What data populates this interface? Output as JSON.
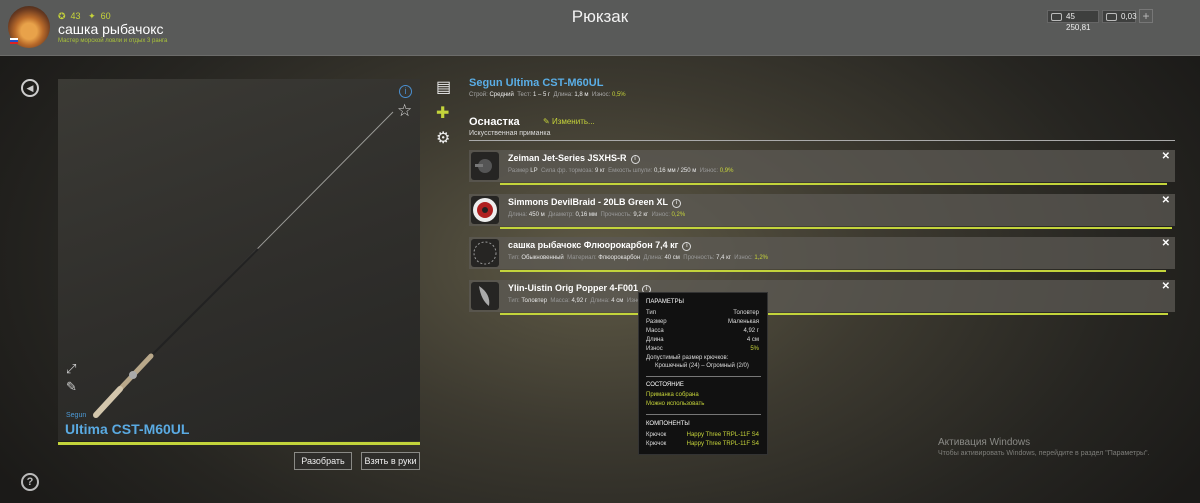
{
  "header": {
    "title": "Рюкзак",
    "level": "43",
    "points": "60",
    "username": "сашка рыбачокс",
    "rank": "Мастер морской ловли и отдых 3 ранга",
    "silver": "45 250,81",
    "gold": "0,03",
    "plus": "+"
  },
  "preview": {
    "info_glyph": "i",
    "brand": "Segun",
    "model": "Ultima CST-M60UL",
    "disassemble_label": "Разобрать",
    "take_label": "Взять в руки"
  },
  "rod": {
    "name": "Segun Ultima CST-M60UL",
    "props": [
      {
        "label": "Строй:",
        "value": "Средний"
      },
      {
        "label": "Тест:",
        "value": "1 – 5 г"
      },
      {
        "label": "Длина:",
        "value": "1,8 м"
      },
      {
        "label": "Износ:",
        "value": "0,5%"
      }
    ]
  },
  "tackle": {
    "section_title": "Оснастка",
    "change_label": "Изменить...",
    "lure_type": "Искусственная приманка",
    "items": [
      {
        "name": "Zeiman Jet-Series JSXHS-R",
        "info": "i",
        "p1l": "Размер",
        "p1v": "LP",
        "p2l": "Сила фр. тормоза:",
        "p2v": "9 кг",
        "p3l": "Емкость шпули:",
        "p3v": "0,16 мм / 250 м",
        "p4l": "Износ:",
        "p4v": "0,9%"
      },
      {
        "name": "Simmons DevilBraid - 20LB Green XL",
        "info": "i",
        "p1l": "Длина:",
        "p1v": "450 м",
        "p2l": "Диаметр:",
        "p2v": "0,16 мм",
        "p3l": "Прочность:",
        "p3v": "9,2 кг",
        "p4l": "Износ:",
        "p4v": "0,2%"
      },
      {
        "name": "сашка рыбачокс Флюорокарбон 7,4 кг",
        "info": "i",
        "p1l": "Тип:",
        "p1v": "Обыкновенный",
        "p2l": "Материал:",
        "p2v": "Флюорокарбон",
        "p3l": "Длина:",
        "p3v": "40 см",
        "p4l": "Прочность:",
        "p4v": "7,4 кг",
        "p5l": "Износ:",
        "p5v": "1,2%"
      },
      {
        "name": "Ylin-Uistin Orig Popper 4-F001",
        "info": "i",
        "p1l": "Тип:",
        "p1v": "Толовтер",
        "p2l": "Масса:",
        "p2v": "4,92 г",
        "p3l": "Длина:",
        "p3v": "4 см",
        "p4l": "Износ:",
        "p4v": ""
      }
    ],
    "close_glyph": "✕"
  },
  "tooltip": {
    "params_title": "ПАРАМЕТРЫ",
    "rows": [
      {
        "k": "Тип",
        "v": "Толовтер"
      },
      {
        "k": "Размер",
        "v": "Маленькая"
      },
      {
        "k": "Масса",
        "v": "4,92 г"
      },
      {
        "k": "Длина",
        "v": "4 см"
      },
      {
        "k": "Износ",
        "v": "5%"
      }
    ],
    "hook_size_label": "Допустимый размер крючков:",
    "hook_size_value": "Крошечный (24) – Огромный (2/0)",
    "state_title": "СОСТОЯНИЕ",
    "state1": "Приманка собрана",
    "state2": "Можно использовать",
    "components_title": "КОМПОНЕНТЫ",
    "comp1_k": "Крючок",
    "comp1_v": "Happy Three TRPL-11F S4",
    "comp2_k": "Крючок",
    "comp2_v": "Happy Three TRPL-11F S4"
  },
  "watermark": {
    "line1": "Активация Windows",
    "line2": "Чтобы активировать Windows, перейдите в раздел \"Параметры\"."
  },
  "colors": {
    "accent": "#c3d43b",
    "link": "#5aaee6"
  },
  "icons": [
    "back-icon",
    "help-icon",
    "info-icon",
    "star-icon",
    "expand-icon",
    "wrench-icon",
    "document-icon",
    "puzzle-icon",
    "gear-icon",
    "edit-icon",
    "close-icon",
    "currency-icon"
  ],
  "wear": {
    "reel": 0.009,
    "line": 0.002,
    "leader": 0.012,
    "lure": 0.05
  }
}
